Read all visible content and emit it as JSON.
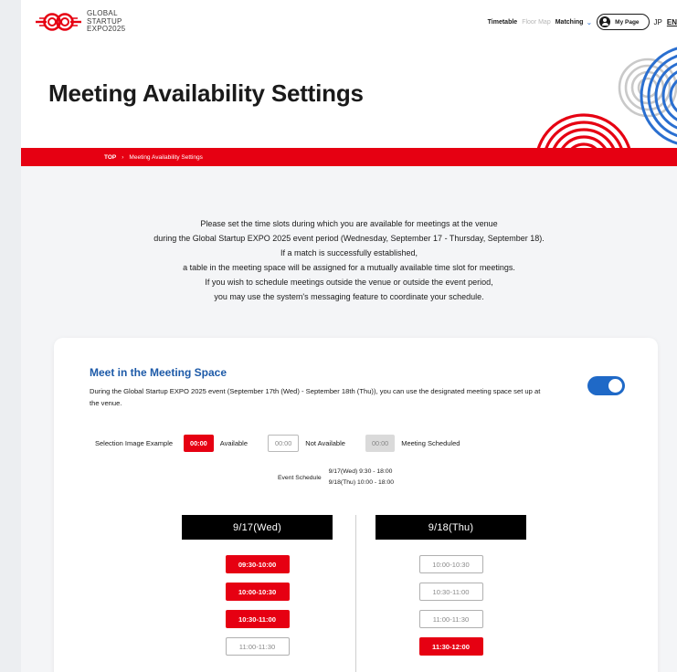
{
  "header": {
    "logo_lines": [
      "GLOBAL",
      "STARTUP",
      "EXPO2025"
    ],
    "nav": {
      "timetable": "Timetable",
      "floor_map": "Floor Map",
      "matching": "Matching",
      "my_page": "My Page",
      "lang_jp": "JP",
      "lang_en": "EN"
    }
  },
  "hero": {
    "title": "Meeting Availability Settings"
  },
  "breadcrumb": {
    "top": "TOP",
    "current": "Meeting Availability Settings"
  },
  "intro": [
    "Please set the time slots during which you are available for meetings at the venue",
    "during the Global Startup EXPO 2025 event period (Wednesday, September 17 - Thursday, September 18).",
    "If a match is successfully established,",
    "a table in the meeting space will be assigned for a mutually available time slot for meetings.",
    "If you wish to schedule meetings outside the venue or outside the event period,",
    "you may use the system's messaging feature to coordinate your schedule."
  ],
  "card": {
    "title": "Meet in the Meeting Space",
    "description": "During the Global Startup EXPO 2025 event (September 17th (Wed) - September 18th (Thu)), you can use the designated meeting space set up at the venue.",
    "toggle_on": true,
    "legend": {
      "label": "Selection Image Example",
      "available_chip": "00:00",
      "available_text": "Available",
      "not_available_chip": "00:00",
      "not_available_text": "Not Available",
      "scheduled_chip": "00:00",
      "scheduled_text": "Meeting Scheduled"
    },
    "schedule": {
      "label": "Event Schedule",
      "lines": [
        "9/17(Wed)  9:30 - 18:00",
        "9/18(Thu)  10:00 - 18:00"
      ]
    },
    "days": [
      {
        "label": "9/17(Wed)",
        "slots": [
          {
            "time": "09:30-10:00",
            "available": true
          },
          {
            "time": "10:00-10:30",
            "available": true
          },
          {
            "time": "10:30-11:00",
            "available": true
          },
          {
            "time": "11:00-11:30",
            "available": false
          }
        ]
      },
      {
        "label": "9/18(Thu)",
        "slots": [
          {
            "time": "10:00-10:30",
            "available": false
          },
          {
            "time": "10:30-11:00",
            "available": false
          },
          {
            "time": "11:00-11:30",
            "available": false
          },
          {
            "time": "11:30-12:00",
            "available": true
          }
        ]
      }
    ]
  },
  "colors": {
    "brand_red": "#e60012",
    "accent_blue": "#1d5aa8",
    "toggle_blue": "#1f69c7"
  }
}
